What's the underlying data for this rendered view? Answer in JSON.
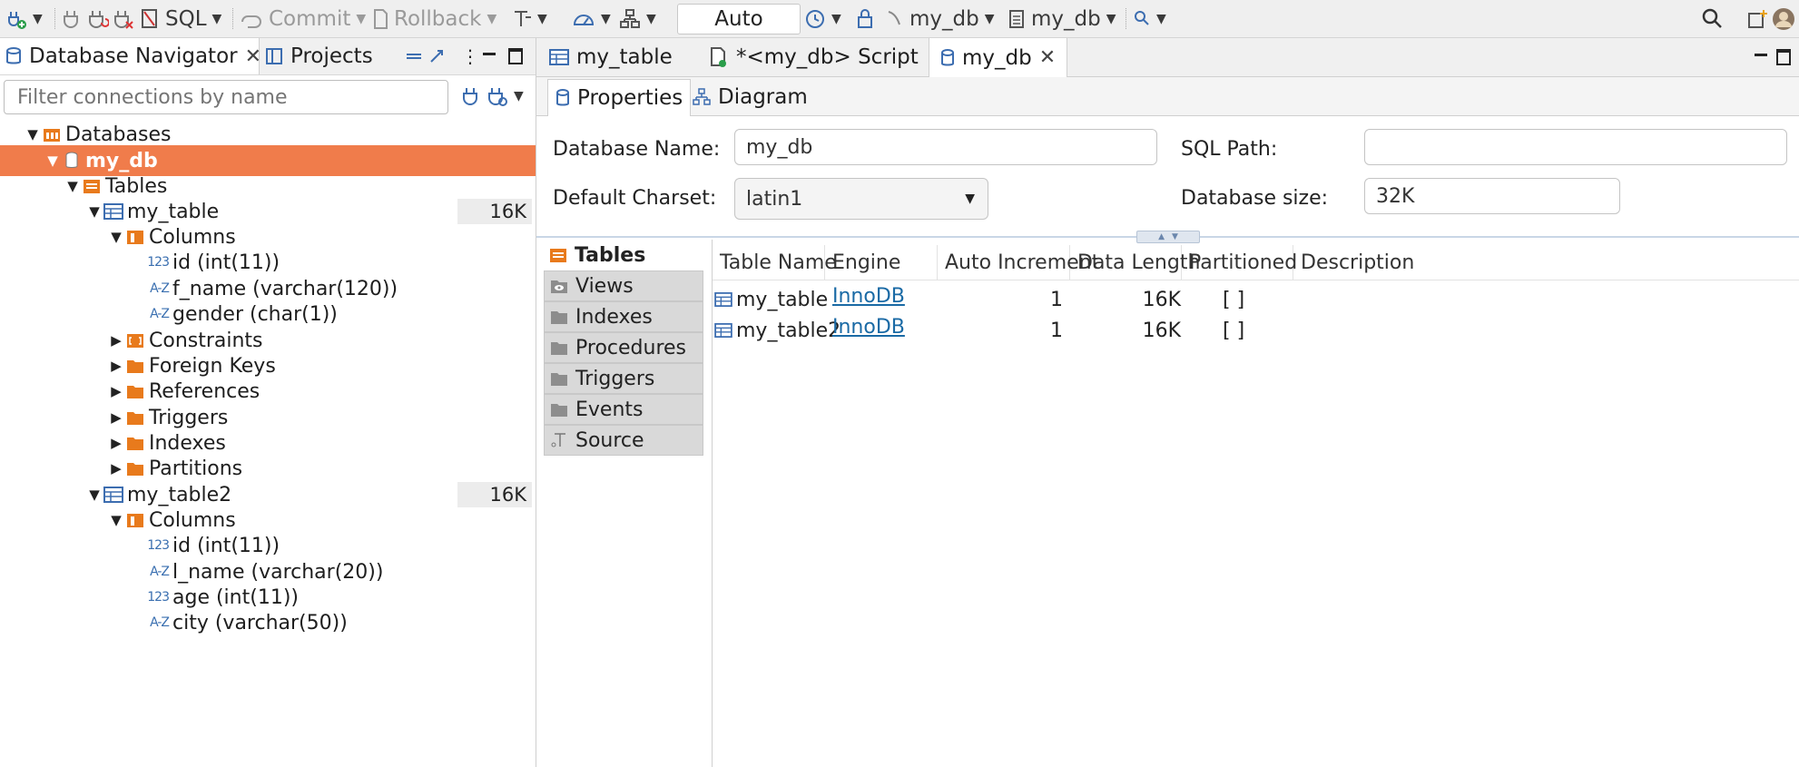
{
  "toolbar": {
    "sql_label": "SQL",
    "commit_label": "Commit",
    "rollback_label": "Rollback",
    "transaction_mode": "Auto",
    "datasource_label": "my_db",
    "schema_label": "my_db"
  },
  "navigator": {
    "tab_db_nav": "Database Navigator",
    "tab_projects": "Projects",
    "filter_placeholder": "Filter connections by name",
    "tree": {
      "databases": "Databases",
      "my_db": "my_db",
      "tables": "Tables",
      "my_table": {
        "label": "my_table",
        "size": "16K",
        "columns_label": "Columns",
        "columns": [
          {
            "type": "123",
            "label": "id (int(11))"
          },
          {
            "type": "A-Z",
            "label": "f_name (varchar(120))"
          },
          {
            "type": "A-Z",
            "label": "gender (char(1))"
          }
        ],
        "folders": [
          "Constraints",
          "Foreign Keys",
          "References",
          "Triggers",
          "Indexes",
          "Partitions"
        ]
      },
      "my_table2": {
        "label": "my_table2",
        "size": "16K",
        "columns_label": "Columns",
        "columns": [
          {
            "type": "123",
            "label": "id (int(11))"
          },
          {
            "type": "A-Z",
            "label": "l_name (varchar(20))"
          },
          {
            "type": "123",
            "label": "age (int(11))"
          },
          {
            "type": "A-Z",
            "label": "city (varchar(50))"
          }
        ]
      }
    }
  },
  "editor": {
    "tabs": [
      "my_table",
      "*<my_db> Script",
      "my_db"
    ],
    "subtabs": [
      "Properties",
      "Diagram"
    ],
    "form": {
      "db_name_label": "Database Name:",
      "db_name_value": "my_db",
      "sql_path_label": "SQL Path:",
      "sql_path_value": "",
      "charset_label": "Default Charset:",
      "charset_value": "latin1",
      "db_size_label": "Database size:",
      "db_size_value": "32K"
    },
    "side_nav": [
      "Tables",
      "Views",
      "Indexes",
      "Procedures",
      "Triggers",
      "Events",
      "Source"
    ],
    "table": {
      "headers": [
        "Table Name",
        "Engine",
        "Auto Increment",
        "Data Length",
        "Partitioned",
        "Description"
      ],
      "rows": [
        {
          "name": "my_table",
          "engine": "InnoDB",
          "auto_inc": "1",
          "data_len": "16K",
          "partitioned": "[ ]",
          "desc": ""
        },
        {
          "name": "my_table2",
          "engine": "InnoDB",
          "auto_inc": "1",
          "data_len": "16K",
          "partitioned": "[ ]",
          "desc": ""
        }
      ]
    }
  },
  "colors": {
    "selection": "#f07c4b",
    "folder": "#e87a1c",
    "link": "#1a6aa5"
  }
}
